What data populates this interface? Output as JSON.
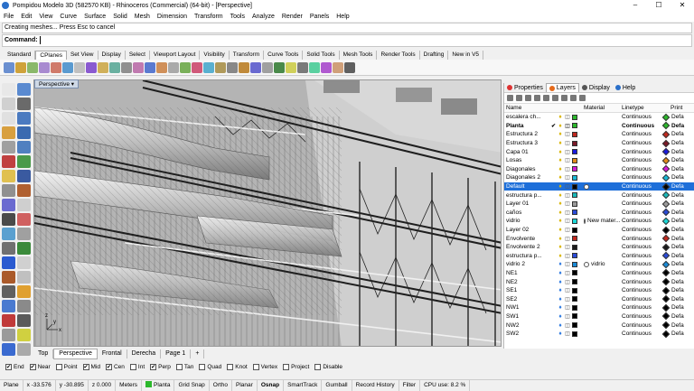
{
  "window": {
    "title": "Pompidou Modelo 3D (582570 KB) - Rhinoceros (Commercial) (64-bit) - [Perspective]"
  },
  "menu": [
    "File",
    "Edit",
    "View",
    "Curve",
    "Surface",
    "Solid",
    "Mesh",
    "Dimension",
    "Transform",
    "Tools",
    "Analyze",
    "Render",
    "Panels",
    "Help"
  ],
  "command": {
    "history": "Creating meshes... Press Esc to cancel",
    "prompt": "Command:"
  },
  "toolbar_tabs": [
    "Standard",
    "CPlanes",
    "Set View",
    "Display",
    "Select",
    "Viewport Layout",
    "Visibility",
    "Transform",
    "Curve Tools",
    "Solid Tools",
    "Mesh Tools",
    "Render Tools",
    "Drafting",
    "New in V5"
  ],
  "toolbar_active": "CPlanes",
  "viewport": {
    "name": "Perspective",
    "axes": {
      "x": "x",
      "y": "y",
      "z": "z"
    }
  },
  "viewport_tabs": [
    "Top",
    "Perspective",
    "Frontal",
    "Derecha",
    "Page 1"
  ],
  "viewport_active": "Perspective",
  "add_tab_icon": "+",
  "panel": {
    "tabs": [
      {
        "label": "Properties",
        "color": "#d33"
      },
      {
        "label": "Layers",
        "color": "#e56a1a"
      },
      {
        "label": "Display",
        "color": "#555"
      },
      {
        "label": "Help",
        "color": "#2a6fc9"
      }
    ],
    "active_tab": "Layers",
    "columns": {
      "name": "Name",
      "material": "Material",
      "linetype": "Linetype",
      "print": "Print"
    },
    "layers": [
      {
        "name": "escalera ch...",
        "current": "",
        "bulb": "yellow",
        "color": "#2cb82c",
        "material": "",
        "linetype": "Continuous",
        "pcolor": "#2cb82c",
        "print": "Defa",
        "bold": false,
        "selected": false
      },
      {
        "name": "Planta",
        "current": "✔",
        "bulb": "yellow",
        "color": "#2cb82c",
        "material": "",
        "linetype": "Continuous",
        "pcolor": "#2cb82c",
        "print": "Defa",
        "bold": true,
        "selected": false
      },
      {
        "name": "Estructura 2",
        "current": "",
        "bulb": "yellow",
        "color": "#c0281e",
        "material": "",
        "linetype": "Continuous",
        "pcolor": "#c0281e",
        "print": "Defa",
        "bold": false,
        "selected": false
      },
      {
        "name": "Estructura 3",
        "current": "",
        "bulb": "yellow",
        "color": "#7a1a28",
        "material": "",
        "linetype": "Continuous",
        "pcolor": "#7a1a28",
        "print": "Defa",
        "bold": false,
        "selected": false
      },
      {
        "name": "Capa 01",
        "current": "",
        "bulb": "yellow",
        "color": "#1a1adc",
        "material": "",
        "linetype": "Continuous",
        "pcolor": "#1a1adc",
        "print": "Defa",
        "bold": false,
        "selected": false
      },
      {
        "name": "Losas",
        "current": "",
        "bulb": "yellow",
        "color": "#e08a1a",
        "material": "",
        "linetype": "Continuous",
        "pcolor": "#e08a1a",
        "print": "Defa",
        "bold": false,
        "selected": false
      },
      {
        "name": "Diagonales",
        "current": "",
        "bulb": "yellow",
        "color": "#d61ad6",
        "material": "",
        "linetype": "Continuous",
        "pcolor": "#d61ad6",
        "print": "Defa",
        "bold": false,
        "selected": false
      },
      {
        "name": "Diagonales 2",
        "current": "",
        "bulb": "yellow",
        "color": "#1ab8d6",
        "material": "",
        "linetype": "Continuous",
        "pcolor": "#1ab8d6",
        "print": "Defa",
        "bold": false,
        "selected": false
      },
      {
        "name": "Default",
        "current": "",
        "bulb": "yellow",
        "color": "#000000",
        "material": "circle",
        "linetype": "Continuous",
        "pcolor": "#000000",
        "print": "Defa",
        "bold": false,
        "selected": true
      },
      {
        "name": "estructura p...",
        "current": "",
        "bulb": "yellow",
        "color": "#1ab8b8",
        "material": "",
        "linetype": "Continuous",
        "pcolor": "#1ab8b8",
        "print": "Defa",
        "bold": false,
        "selected": false
      },
      {
        "name": "Layer 01",
        "current": "",
        "bulb": "yellow",
        "color": "#9a9a9a",
        "material": "",
        "linetype": "Continuous",
        "pcolor": "#9a9a9a",
        "print": "Defa",
        "bold": false,
        "selected": false
      },
      {
        "name": "caños",
        "current": "",
        "bulb": "yellow",
        "color": "#2a4ad6",
        "material": "",
        "linetype": "Continuous",
        "pcolor": "#2a4ad6",
        "print": "Defa",
        "bold": false,
        "selected": false
      },
      {
        "name": "vidrio",
        "current": "",
        "bulb": "yellow",
        "color": "#1ad6d6",
        "material": "New mater...",
        "linetype": "Continuous",
        "pcolor": "#1ad6d6",
        "print": "Defa",
        "bold": false,
        "selected": false
      },
      {
        "name": "Layer 02",
        "current": "",
        "bulb": "yellow",
        "color": "#000000",
        "material": "",
        "linetype": "Continuous",
        "pcolor": "#000000",
        "print": "Defa",
        "bold": false,
        "selected": false
      },
      {
        "name": "Envolvente",
        "current": "",
        "bulb": "yellow",
        "color": "#c0281e",
        "material": "",
        "linetype": "Continuous",
        "pcolor": "#c0281e",
        "print": "Defa",
        "bold": false,
        "selected": false
      },
      {
        "name": "Envolvente 2",
        "current": "",
        "bulb": "yellow",
        "color": "#1a1a1a",
        "material": "",
        "linetype": "Continuous",
        "pcolor": "#1a1a1a",
        "print": "Defa",
        "bold": false,
        "selected": false
      },
      {
        "name": "estructura p...",
        "current": "",
        "bulb": "yellow",
        "color": "#2a4ad6",
        "material": "",
        "linetype": "Continuous",
        "pcolor": "#2a4ad6",
        "print": "Defa",
        "bold": false,
        "selected": false
      },
      {
        "name": "vidrio 2",
        "current": "",
        "bulb": "blue",
        "color": "#1a8ad6",
        "material": "vidrio",
        "linetype": "Continuous",
        "pcolor": "#1a8ad6",
        "print": "Defa",
        "bold": false,
        "selected": false
      },
      {
        "name": "NE1",
        "current": "",
        "bulb": "blue",
        "color": "#000000",
        "material": "",
        "linetype": "Continuous",
        "pcolor": "#000000",
        "print": "Defa",
        "bold": false,
        "selected": false
      },
      {
        "name": "NE2",
        "current": "",
        "bulb": "blue",
        "color": "#000000",
        "material": "",
        "linetype": "Continuous",
        "pcolor": "#000000",
        "print": "Defa",
        "bold": false,
        "selected": false
      },
      {
        "name": "SE1",
        "current": "",
        "bulb": "blue",
        "color": "#000000",
        "material": "",
        "linetype": "Continuous",
        "pcolor": "#000000",
        "print": "Defa",
        "bold": false,
        "selected": false
      },
      {
        "name": "SE2",
        "current": "",
        "bulb": "blue",
        "color": "#000000",
        "material": "",
        "linetype": "Continuous",
        "pcolor": "#000000",
        "print": "Defa",
        "bold": false,
        "selected": false
      },
      {
        "name": "NW1",
        "current": "",
        "bulb": "blue",
        "color": "#000000",
        "material": "",
        "linetype": "Continuous",
        "pcolor": "#000000",
        "print": "Defa",
        "bold": false,
        "selected": false
      },
      {
        "name": "SW1",
        "current": "",
        "bulb": "blue",
        "color": "#000000",
        "material": "",
        "linetype": "Continuous",
        "pcolor": "#000000",
        "print": "Defa",
        "bold": false,
        "selected": false
      },
      {
        "name": "NW2",
        "current": "",
        "bulb": "blue",
        "color": "#000000",
        "material": "",
        "linetype": "Continuous",
        "pcolor": "#000000",
        "print": "Defa",
        "bold": false,
        "selected": false
      },
      {
        "name": "SW2",
        "current": "",
        "bulb": "blue",
        "color": "#000000",
        "material": "",
        "linetype": "Continuous",
        "pcolor": "#000000",
        "print": "Defa",
        "bold": false,
        "selected": false
      }
    ]
  },
  "osnap": [
    {
      "label": "End",
      "checked": true
    },
    {
      "label": "Near",
      "checked": true
    },
    {
      "label": "Point",
      "checked": false
    },
    {
      "label": "Mid",
      "checked": true
    },
    {
      "label": "Cen",
      "checked": true
    },
    {
      "label": "Int",
      "checked": false
    },
    {
      "label": "Perp",
      "checked": true
    },
    {
      "label": "Tan",
      "checked": false
    },
    {
      "label": "Quad",
      "checked": false
    },
    {
      "label": "Knot",
      "checked": false
    },
    {
      "label": "Vertex",
      "checked": false
    },
    {
      "label": "Project",
      "checked": false
    },
    {
      "label": "Disable",
      "checked": false
    }
  ],
  "status": {
    "plane": "Plane",
    "x": "x -33.576",
    "y": "y -30.895",
    "z": "z 0.000",
    "units": "Meters",
    "layer": "Planta",
    "layer_color": "#2cb82c",
    "buttons": [
      "Grid Snap",
      "Ortho",
      "Planar",
      "Osnap",
      "SmartTrack",
      "Gumball",
      "Record History",
      "Filter"
    ],
    "osnap_on": "Osnap",
    "cpu": "CPU use: 8.2 %"
  }
}
